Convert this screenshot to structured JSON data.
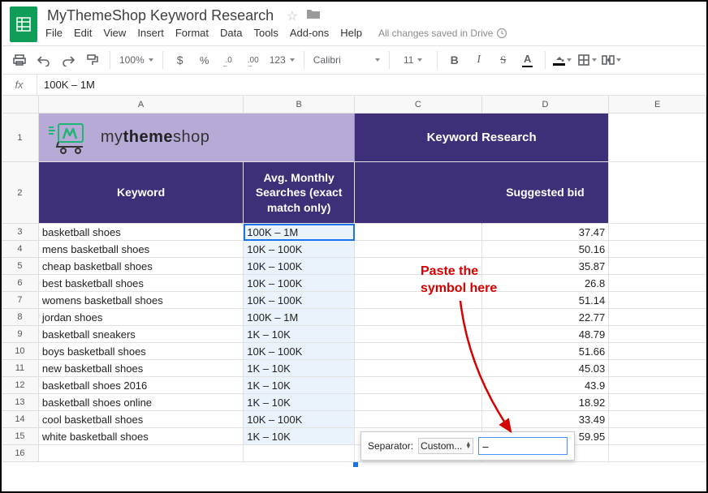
{
  "doc": {
    "title": "MyThemeShop Keyword Research",
    "save_status": "All changes saved in Drive"
  },
  "menu": {
    "file": "File",
    "edit": "Edit",
    "view": "View",
    "insert": "Insert",
    "format": "Format",
    "data": "Data",
    "tools": "Tools",
    "addons": "Add-ons",
    "help": "Help"
  },
  "toolbar": {
    "zoom": "100%",
    "currency": "$",
    "percent": "%",
    "dec_dec": ".0",
    "dec_inc": ".00",
    "numfmt": "123",
    "font": "Calibri",
    "fontsize": "11",
    "bold": "B",
    "italic": "I",
    "strike": "S",
    "textcolor": "A"
  },
  "formula": {
    "fx": "fx",
    "value": "100K – 1M"
  },
  "columns": {
    "A": "A",
    "B": "B",
    "C": "C",
    "D": "D",
    "E": "E"
  },
  "headers": {
    "brand_my": "my",
    "brand_theme": "theme",
    "brand_shop": "shop",
    "keyword_research": "Keyword Research",
    "keyword": "Keyword",
    "searches": "Avg. Monthly Searches (exact match only)",
    "suggested_bid": "Suggested bid"
  },
  "rows": [
    {
      "n": "3",
      "kw": "basketball shoes",
      "vol": "100K – 1M",
      "bid": "37.47"
    },
    {
      "n": "4",
      "kw": "mens basketball shoes",
      "vol": "10K – 100K",
      "bid": "50.16"
    },
    {
      "n": "5",
      "kw": "cheap basketball shoes",
      "vol": "10K – 100K",
      "bid": "35.87"
    },
    {
      "n": "6",
      "kw": "best basketball shoes",
      "vol": "10K – 100K",
      "bid": "26.8"
    },
    {
      "n": "7",
      "kw": "womens basketball shoes",
      "vol": "10K – 100K",
      "bid": "51.14"
    },
    {
      "n": "8",
      "kw": "jordan shoes",
      "vol": "100K – 1M",
      "bid": "22.77"
    },
    {
      "n": "9",
      "kw": "basketball sneakers",
      "vol": "1K – 10K",
      "bid": "48.79"
    },
    {
      "n": "10",
      "kw": "boys basketball shoes",
      "vol": "10K – 100K",
      "bid": "51.66"
    },
    {
      "n": "11",
      "kw": "new basketball shoes",
      "vol": "1K – 10K",
      "bid": "45.03"
    },
    {
      "n": "12",
      "kw": "basketball shoes 2016",
      "vol": "1K – 10K",
      "bid": "43.9"
    },
    {
      "n": "13",
      "kw": "basketball shoes online",
      "vol": "1K – 10K",
      "bid": "18.92"
    },
    {
      "n": "14",
      "kw": "cool basketball shoes",
      "vol": "10K – 100K",
      "bid": "33.49"
    },
    {
      "n": "15",
      "kw": "white basketball shoes",
      "vol": "1K – 10K",
      "bid": "59.95"
    }
  ],
  "last_row": "16",
  "separator_popup": {
    "label": "Separator:",
    "select_value": "Custom...",
    "input_value": "–"
  },
  "annotation": {
    "line1": "Paste the",
    "line2": "symbol here"
  }
}
